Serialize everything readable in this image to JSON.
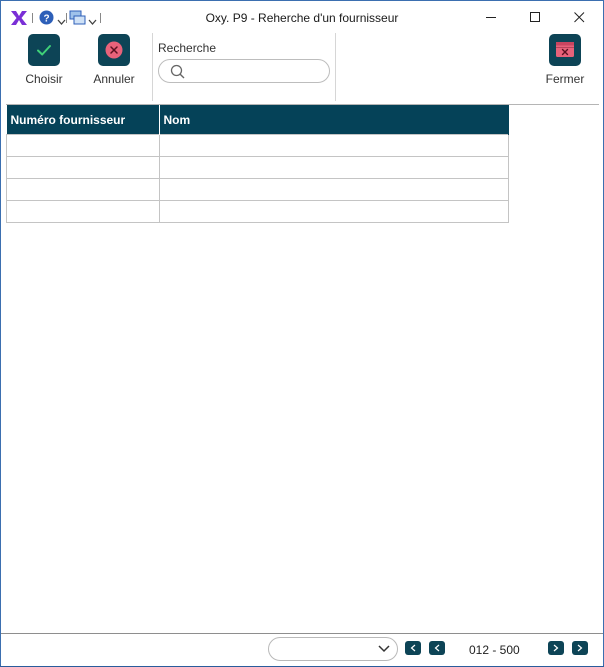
{
  "window": {
    "title": "Oxy. P9 - Reherche d'un fournisseur"
  },
  "titlebar_icons": [
    "oxy-logo-icon",
    "help-icon",
    "chevron-down-icon",
    "windows-icon",
    "chevron-down-icon"
  ],
  "toolbar": {
    "choose_label": "Choisir",
    "cancel_label": "Annuler",
    "close_label": "Fermer",
    "search_label": "Recherche",
    "search_placeholder": "",
    "search_value": ""
  },
  "table": {
    "columns": [
      "Numéro fournisseur",
      "Nom"
    ],
    "rows": [
      [
        "",
        ""
      ],
      [
        "",
        ""
      ],
      [
        "",
        ""
      ],
      [
        "",
        ""
      ]
    ]
  },
  "footer": {
    "dropdown_value": "",
    "range_text": "012 - 500"
  },
  "colors": {
    "accent": "#0d4456",
    "header_bg": "#054258",
    "cancel_red": "#e8627a",
    "logo_purple": "#7a2fd6"
  }
}
